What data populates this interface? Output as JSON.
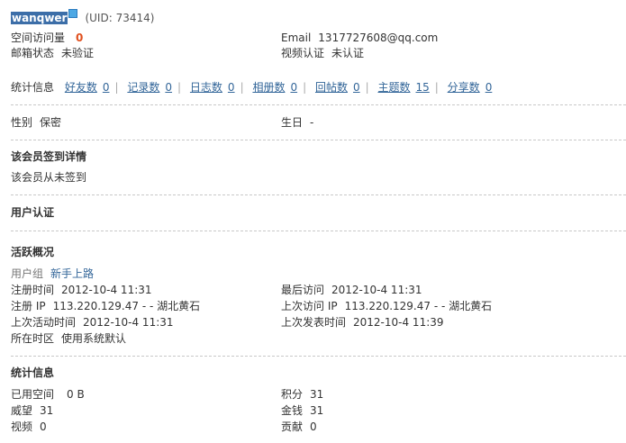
{
  "header": {
    "username": "wanqwer",
    "uid_text": "(UID: 73414)"
  },
  "profile": {
    "visits_label": "空间访问量",
    "visits_value": "0",
    "email_label": "Email",
    "email_value": "1317727608@qq.com",
    "mailbox_label": "邮箱状态",
    "mailbox_value": "未验证",
    "video_label": "视频认证",
    "video_value": "未认证"
  },
  "stats_bar": {
    "label": "统计信息",
    "items": [
      {
        "label": "好友数",
        "value": "0"
      },
      {
        "label": "记录数",
        "value": "0"
      },
      {
        "label": "日志数",
        "value": "0"
      },
      {
        "label": "相册数",
        "value": "0"
      },
      {
        "label": "回帖数",
        "value": "0"
      },
      {
        "label": "主题数",
        "value": "15"
      },
      {
        "label": "分享数",
        "value": "0"
      }
    ],
    "separator": "|"
  },
  "basic": {
    "gender_label": "性别",
    "gender_value": "保密",
    "birthday_label": "生日",
    "birthday_value": "-"
  },
  "checkin": {
    "title": "该会员签到详情",
    "text": "该会员从未签到"
  },
  "auth": {
    "title": "用户认证"
  },
  "activity": {
    "title": "活跃概况",
    "group_label": "用户组",
    "group_value": "新手上路",
    "reg_time_label": "注册时间",
    "reg_time_value": "2012-10-4 11:31",
    "last_visit_label": "最后访问",
    "last_visit_value": "2012-10-4 11:31",
    "reg_ip_label": "注册 IP",
    "reg_ip_value": "113.220.129.47 - - 湖北黄石",
    "last_ip_label": "上次访问 IP",
    "last_ip_value": "113.220.129.47 - - 湖北黄石",
    "last_active_label": "上次活动时间",
    "last_active_value": "2012-10-4 11:31",
    "last_post_label": "上次发表时间",
    "last_post_value": "2012-10-4 11:39",
    "timezone_label": "所在时区",
    "timezone_value": "使用系统默认"
  },
  "statistics": {
    "title": "统计信息",
    "space_label": "已用空间",
    "space_value": "0 B",
    "points_label": "积分",
    "points_value": "31",
    "prestige_label": "威望",
    "prestige_value": "31",
    "money_label": "金钱",
    "money_value": "31",
    "video_label": "视频",
    "video_value": "0",
    "contrib_label": "贡献",
    "contrib_value": "0"
  }
}
